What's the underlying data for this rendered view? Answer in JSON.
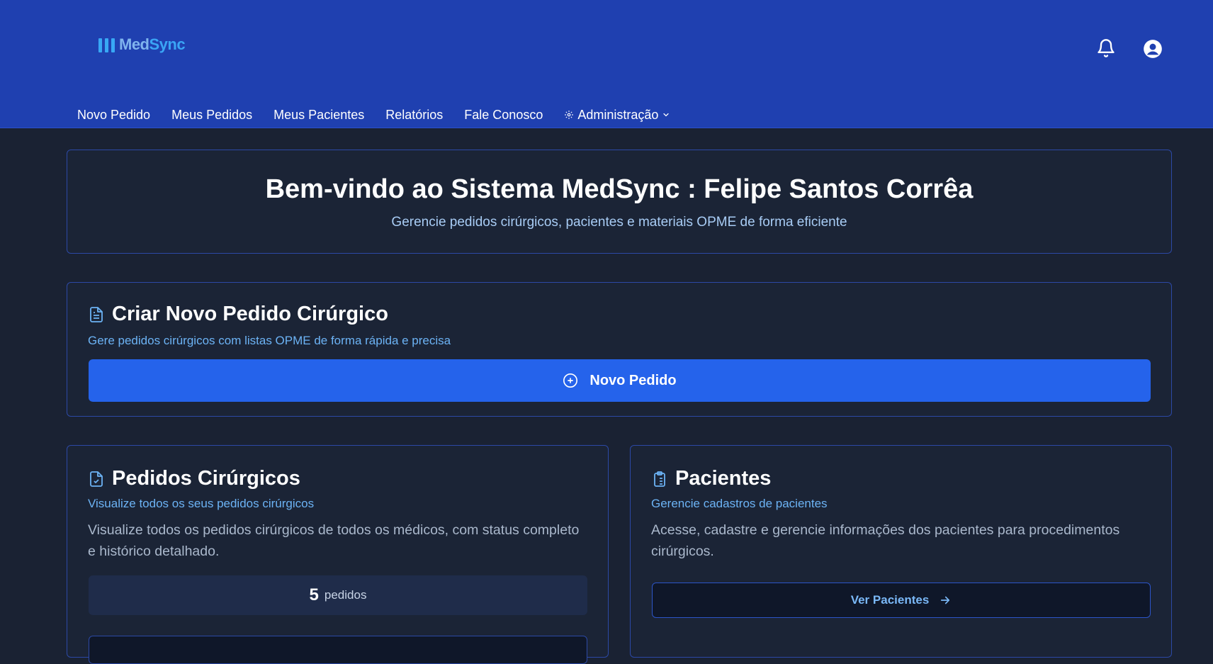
{
  "header": {
    "logo_med": "Med",
    "logo_sync": "Sync",
    "icons": {
      "notifications": "bell-icon",
      "user": "user-circle-icon"
    },
    "nav": [
      {
        "label": "Novo Pedido"
      },
      {
        "label": "Meus Pedidos"
      },
      {
        "label": "Meus Pacientes"
      },
      {
        "label": "Relatórios"
      },
      {
        "label": "Fale Conosco"
      },
      {
        "label": "Administração",
        "icon": "gear-icon",
        "dropdown": true
      }
    ]
  },
  "welcome": {
    "title": "Bem-vindo ao Sistema MedSync : Felipe Santos Corrêa",
    "subtitle": "Gerencie pedidos cirúrgicos, pacientes e materiais OPME de forma eficiente"
  },
  "create_order": {
    "title": "Criar Novo Pedido Cirúrgico",
    "subtitle": "Gere pedidos cirúrgicos com listas OPME de forma rápida e precisa",
    "button_label": "Novo Pedido",
    "icon": "file-text-icon"
  },
  "orders": {
    "title": "Pedidos Cirúrgicos",
    "subtitle": "Visualize todos os seus pedidos cirúrgicos",
    "body": "Visualize todos os pedidos cirúrgicos de todos os médicos, com status completo e histórico detalhado.",
    "count": "5",
    "count_label": "pedidos",
    "icon": "file-check-icon"
  },
  "patients": {
    "title": "Pacientes",
    "subtitle": "Gerencie cadastros de pacientes",
    "body": "Acesse, cadastre e gerencie informações dos pacientes para procedimentos cirúrgicos.",
    "button_label": "Ver Pacientes",
    "icon": "clipboard-icon"
  },
  "colors": {
    "header_bg": "#1f40b0",
    "page_bg": "#1a2233",
    "primary": "#2563eb",
    "accent_text": "#6cb3f5"
  }
}
